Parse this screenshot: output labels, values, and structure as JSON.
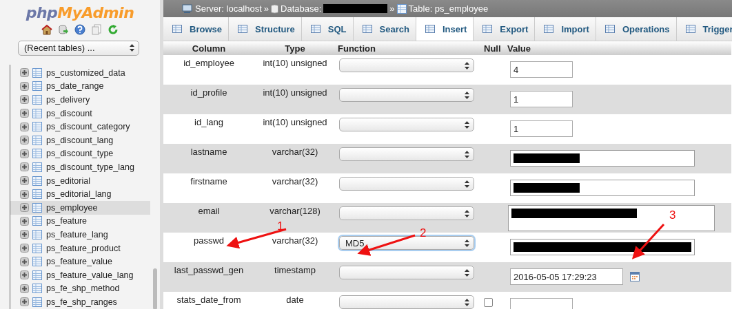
{
  "sidebar": {
    "logo": {
      "part_1": "php",
      "part_2": "MyAdmin"
    },
    "recent_tables": {
      "value": "(Recent tables) ..."
    },
    "items": [
      {
        "label": "ps_customized_data",
        "selected": false
      },
      {
        "label": "ps_date_range",
        "selected": false
      },
      {
        "label": "ps_delivery",
        "selected": false
      },
      {
        "label": "ps_discount",
        "selected": false
      },
      {
        "label": "ps_discount_category",
        "selected": false
      },
      {
        "label": "ps_discount_lang",
        "selected": false
      },
      {
        "label": "ps_discount_type",
        "selected": false
      },
      {
        "label": "ps_discount_type_lang",
        "selected": false
      },
      {
        "label": "ps_editorial",
        "selected": false
      },
      {
        "label": "ps_editorial_lang",
        "selected": false
      },
      {
        "label": "ps_employee",
        "selected": true
      },
      {
        "label": "ps_feature",
        "selected": false
      },
      {
        "label": "ps_feature_lang",
        "selected": false
      },
      {
        "label": "ps_feature_product",
        "selected": false
      },
      {
        "label": "ps_feature_value",
        "selected": false
      },
      {
        "label": "ps_feature_value_lang",
        "selected": false
      },
      {
        "label": "ps_fe_shp_method",
        "selected": false
      },
      {
        "label": "ps_fe_shp_ranges",
        "selected": false
      }
    ]
  },
  "breadcrumb": {
    "server": "Server: localhost",
    "separator_1": "»",
    "database": "Database:",
    "database_redacted": true,
    "separator_2": "»",
    "table": "Table: ps_employee"
  },
  "tabs": [
    {
      "label": "Browse",
      "selected": false
    },
    {
      "label": "Structure",
      "selected": false
    },
    {
      "label": "SQL",
      "selected": false
    },
    {
      "label": "Search",
      "selected": false
    },
    {
      "label": "Insert",
      "selected": true
    },
    {
      "label": "Export",
      "selected": false
    },
    {
      "label": "Import",
      "selected": false
    },
    {
      "label": "Operations",
      "selected": false
    },
    {
      "label": "Trigger",
      "selected": false
    }
  ],
  "table": {
    "columns": [
      "Column",
      "Type",
      "Function",
      "Null",
      "Value"
    ],
    "rows": [
      {
        "column": "id_employee",
        "type": "int(10) unsigned",
        "function": "",
        "focused": false,
        "kind": "short",
        "value": "4",
        "redacted": false
      },
      {
        "column": "id_profile",
        "type": "int(10) unsigned",
        "function": "",
        "focused": false,
        "kind": "short",
        "value": "1",
        "redacted": false
      },
      {
        "column": "id_lang",
        "type": "int(10) unsigned",
        "function": "",
        "focused": false,
        "kind": "short",
        "value": "1",
        "redacted": false
      },
      {
        "column": "lastname",
        "type": "varchar(32)",
        "function": "",
        "focused": false,
        "kind": "wide",
        "redacted": true
      },
      {
        "column": "firstname",
        "type": "varchar(32)",
        "function": "",
        "focused": false,
        "kind": "wide",
        "redacted": true
      },
      {
        "column": "email",
        "type": "varchar(128)",
        "function": "",
        "focused": false,
        "kind": "textarea",
        "redacted": true
      },
      {
        "column": "passwd",
        "type": "varchar(32)",
        "function": "MD5",
        "focused": true,
        "kind": "wide",
        "redacted": true
      },
      {
        "column": "last_passwd_gen",
        "type": "timestamp",
        "function": "",
        "focused": false,
        "kind": "datetime",
        "value": "2016-05-05 17:29:23",
        "redacted": false
      },
      {
        "column": "stats_date_from",
        "type": "date",
        "function": "",
        "focused": false,
        "kind": "short",
        "redacted": false,
        "null_checkbox": {
          "checked": false
        }
      }
    ]
  },
  "annotations": [
    {
      "label": "1"
    },
    {
      "label": "2"
    },
    {
      "label": "3"
    }
  ]
}
